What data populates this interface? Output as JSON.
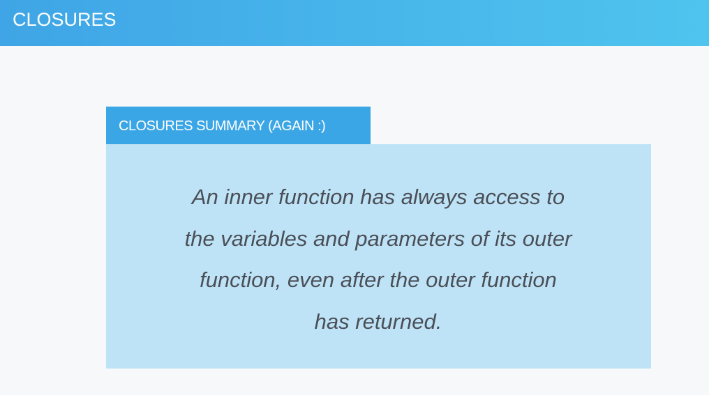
{
  "header": {
    "title": "CLOSURES"
  },
  "summary": {
    "tab_label": "CLOSURES SUMMARY (AGAIN :)",
    "lines": [
      "An inner function has always access to",
      "the variables and parameters of its outer",
      "function, even after the outer function",
      "has returned."
    ]
  }
}
